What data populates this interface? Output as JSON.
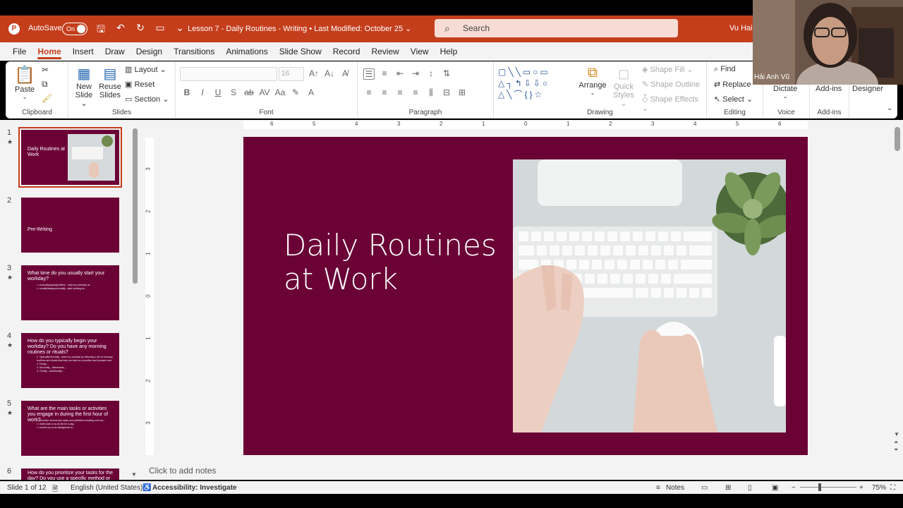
{
  "titlebar": {
    "autosave_label": "AutoSave",
    "toggle_label": "On",
    "document_title": "Lesson 7 - Daily Routines - Writing  •  Last Modified: October 25 ⌄",
    "search_placeholder": "Search",
    "user_name": "Vu Hai"
  },
  "menu": [
    "File",
    "Home",
    "Insert",
    "Draw",
    "Design",
    "Transitions",
    "Animations",
    "Slide Show",
    "Record",
    "Review",
    "View",
    "Help"
  ],
  "ribbon": {
    "clipboard": {
      "paste": "Paste",
      "label": "Clipboard"
    },
    "slides": {
      "new_slide": "New Slide ⌄",
      "reuse_slides": "Reuse Slides",
      "layout": "Layout ⌄",
      "reset": "Reset",
      "section": "Section ⌄",
      "label": "Slides"
    },
    "font": {
      "size": "16",
      "label": "Font"
    },
    "paragraph": {
      "label": "Paragraph"
    },
    "drawing": {
      "arrange": "Arrange",
      "quick_styles": "Quick Styles ⌄",
      "shape_fill": "Shape Fill ⌄",
      "shape_outline": "Shape Outline ⌄",
      "shape_effects": "Shape Effects ⌄",
      "label": "Drawing"
    },
    "editing": {
      "find": "Find",
      "replace": "Replace",
      "select": "Select ⌄",
      "label": "Editing"
    },
    "voice": {
      "dictate": "Dictate",
      "label": "Voice"
    },
    "addins": {
      "addins": "Add-ins",
      "label": "Add-ins"
    },
    "designer": {
      "designer": "Designer"
    }
  },
  "thumbnails": [
    {
      "num": "1",
      "title": "Daily Routines at Work",
      "body": ""
    },
    {
      "num": "2",
      "title": "Pre-Writing",
      "body": ""
    },
    {
      "num": "3",
      "title": "What time do you usually start your workday?",
      "body": "• I normally/typically/often/... start my workday at...\n• I usually/always/normally...start working at..."
    },
    {
      "num": "4",
      "title": "How do you typically begin your workday? Do you have any morning routines or rituals?",
      "body": "1. Typically/Normally, I start my workday by following a set of morning routines and rituals that help me start on a positive and focused note.\n2. Firstly,...\n3. Secondly,...Afterwards,...\n4. Thirdly,...Additionally,..."
    },
    {
      "num": "5",
      "title": "What are the main tasks or activities you engage in during the first hour of work?",
      "body": "• I prioritize several key tasks and activities including such as...\n• I write down a to-do list for a day.\n• I review my to-do list/agenda to..."
    },
    {
      "num": "6",
      "title": "How do you prioritize your tasks for the day? Do you use a specific method or",
      "body": ""
    }
  ],
  "ruler": {
    "h_ticks": [
      "6",
      "5",
      "4",
      "3",
      "2",
      "1",
      "0",
      "1",
      "2",
      "3",
      "4",
      "5",
      "6"
    ],
    "v_ticks": [
      "3",
      "2",
      "1",
      "0",
      "1",
      "2",
      "3"
    ]
  },
  "slide": {
    "title_line1": "Daily Routines",
    "title_line2": "at Work",
    "background": "#6b0236"
  },
  "notes_placeholder": "Click to add notes",
  "status": {
    "slide_of": "Slide 1 of 12",
    "language": "English (United States)",
    "accessibility": "Accessibility: Investigate",
    "notes": "Notes",
    "zoom": "75%"
  },
  "video": {
    "participant_name": "Hải Anh Vũ"
  },
  "colors": {
    "accent": "#c43e1c",
    "slide_bg": "#6b0236"
  }
}
